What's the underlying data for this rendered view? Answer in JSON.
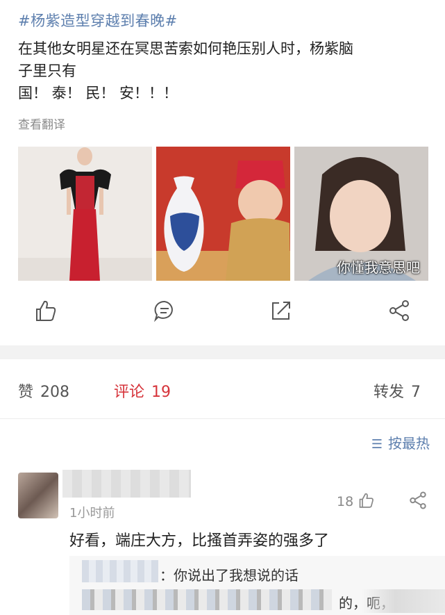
{
  "post": {
    "hashtag": "#杨紫造型穿越到春晚#",
    "text_line1": "在其他女明星还在冥思苦索如何艳压别人时，杨紫脑",
    "text_line2": "子里只有",
    "text_line3": "国！ 泰！ 民！ 安！！！",
    "translate": "查看翻译",
    "images": [
      {
        "caption": ""
      },
      {
        "caption": ""
      },
      {
        "caption": "你懂我意思吧"
      }
    ],
    "actions": [
      "like-icon",
      "comment-icon",
      "repost-icon",
      "share-icon"
    ]
  },
  "stats": {
    "likes_label": "赞",
    "likes_count": "208",
    "comments_label": "评论",
    "comments_count": "19",
    "reposts_label": "转发",
    "reposts_count": "7"
  },
  "sort": {
    "label": "按最热",
    "icon": "sort-icon"
  },
  "comment": {
    "time": "1小时前",
    "likes": "18",
    "text": "好看，端庄大方，比搔首弄姿的强多了",
    "reply1": "：你说出了我想说的话",
    "reply2_tail": "的，呃，这"
  },
  "colors": {
    "link": "#5d7fae",
    "active": "#d6333a"
  }
}
